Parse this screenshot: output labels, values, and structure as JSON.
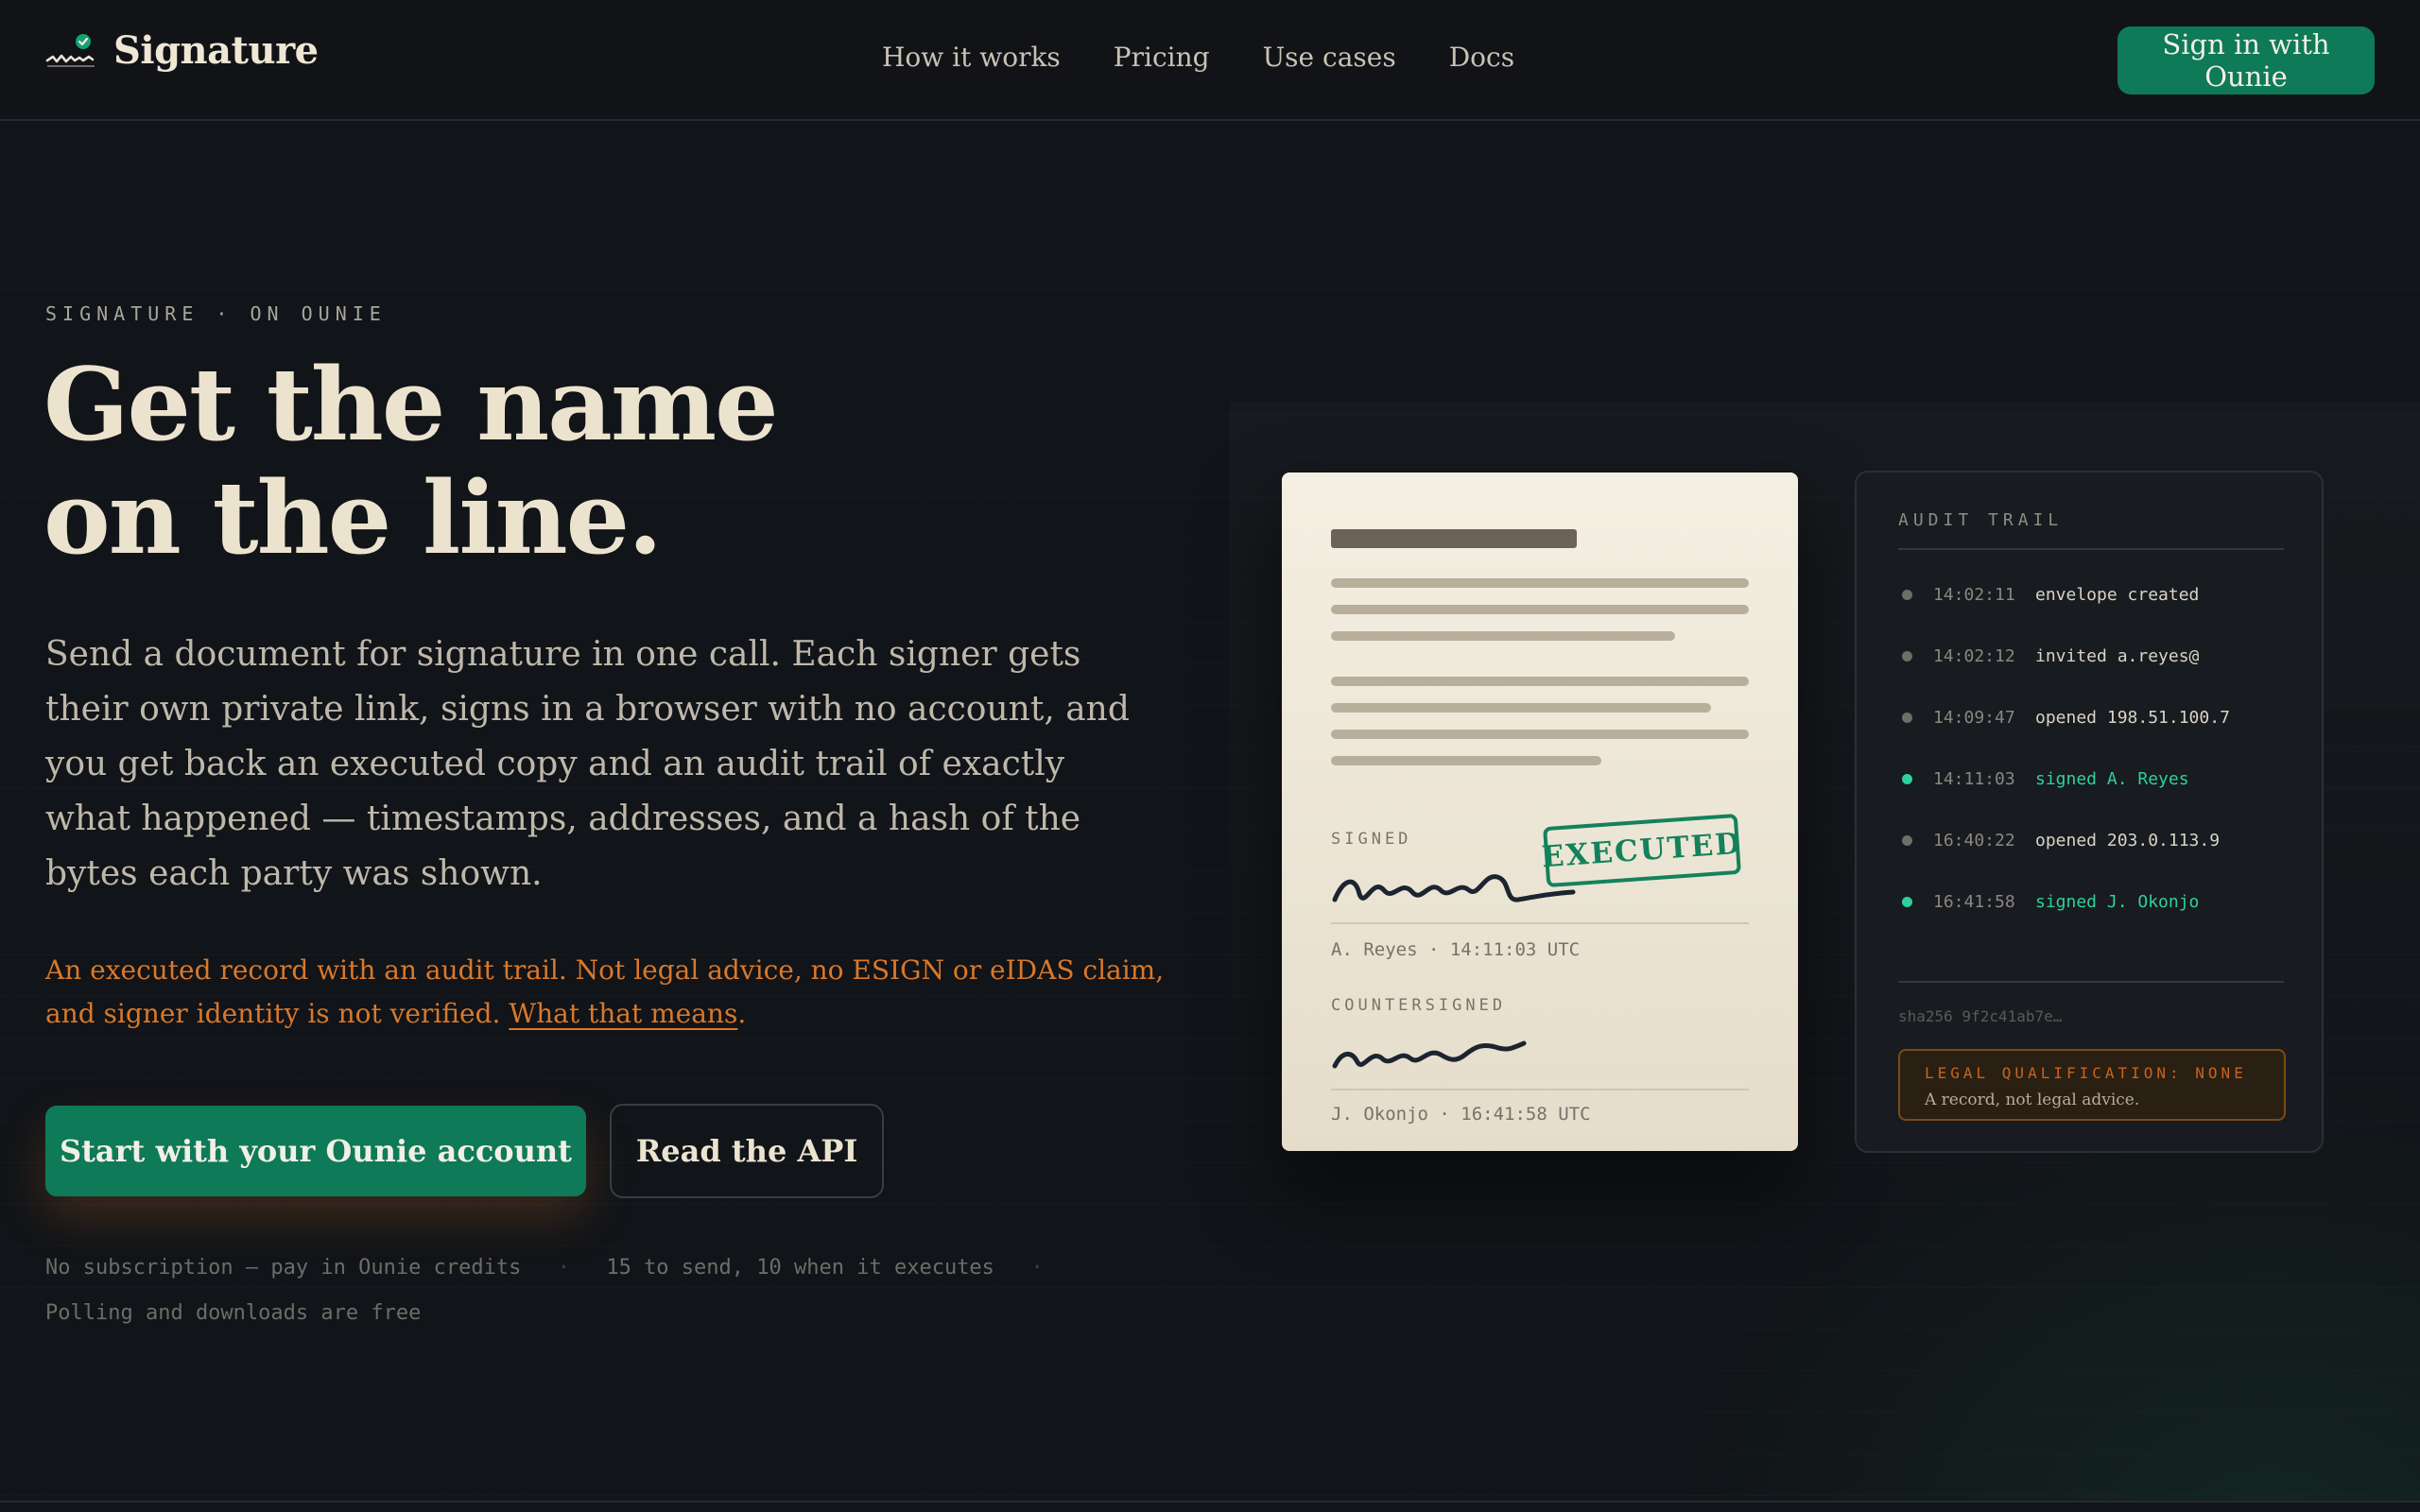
{
  "brand": {
    "name": "Signature",
    "icon": "signature-check-icon"
  },
  "nav": {
    "links": [
      "How it works",
      "Pricing",
      "Use cases",
      "Docs"
    ],
    "cta": "Sign in with Ounie"
  },
  "hero": {
    "eyebrow": "SIGNATURE · ON OUNIE",
    "headline_line1": "Get the name",
    "headline_line2": "on the line.",
    "lede": "Send a document for signature in one call. Each signer gets their own private link, signs in a browser with no account, and you get back an executed copy and an audit trail of exactly what happened — timestamps, addresses, and a hash of the bytes each party was shown.",
    "warning": "An executed record with an audit trail. Not legal advice, no ESIGN or eIDAS claim, and signer identity is not verified.",
    "warning_link": "What that means",
    "primary_button": "Start with your Ounie account",
    "secondary_button": "Read the API",
    "footnotes": [
      "No subscription — pay in Ounie credits",
      "15 to send, 10 when it executes",
      "Polling and downloads are free"
    ]
  },
  "document": {
    "signed_label": "SIGNED",
    "signed_caption": "A. Reyes · 14:11:03 UTC",
    "countersigned_label": "COUNTERSIGNED",
    "countersigned_caption": "J. Okonjo · 16:41:58 UTC",
    "stamp": "EXECUTED"
  },
  "audit": {
    "title": "AUDIT TRAIL",
    "events": [
      {
        "time": "14:02:11",
        "event": "envelope created",
        "signed": false
      },
      {
        "time": "14:02:12",
        "event": "invited a.reyes@",
        "signed": false
      },
      {
        "time": "14:09:47",
        "event": "opened 198.51.100.7",
        "signed": false
      },
      {
        "time": "14:11:03",
        "event": "signed A. Reyes",
        "signed": true
      },
      {
        "time": "16:40:22",
        "event": "opened 203.0.113.9",
        "signed": false
      },
      {
        "time": "16:41:58",
        "event": "signed J. Okonjo",
        "signed": true
      }
    ],
    "hash": "sha256 9f2c41ab7e…",
    "legal_tag": "LEGAL QUALIFICATION: NONE",
    "legal_text": "A record, not legal advice."
  },
  "colors": {
    "accent": "#0f7a57",
    "warning": "#d9782a",
    "signed": "#2fd19a",
    "background": "#111418"
  }
}
